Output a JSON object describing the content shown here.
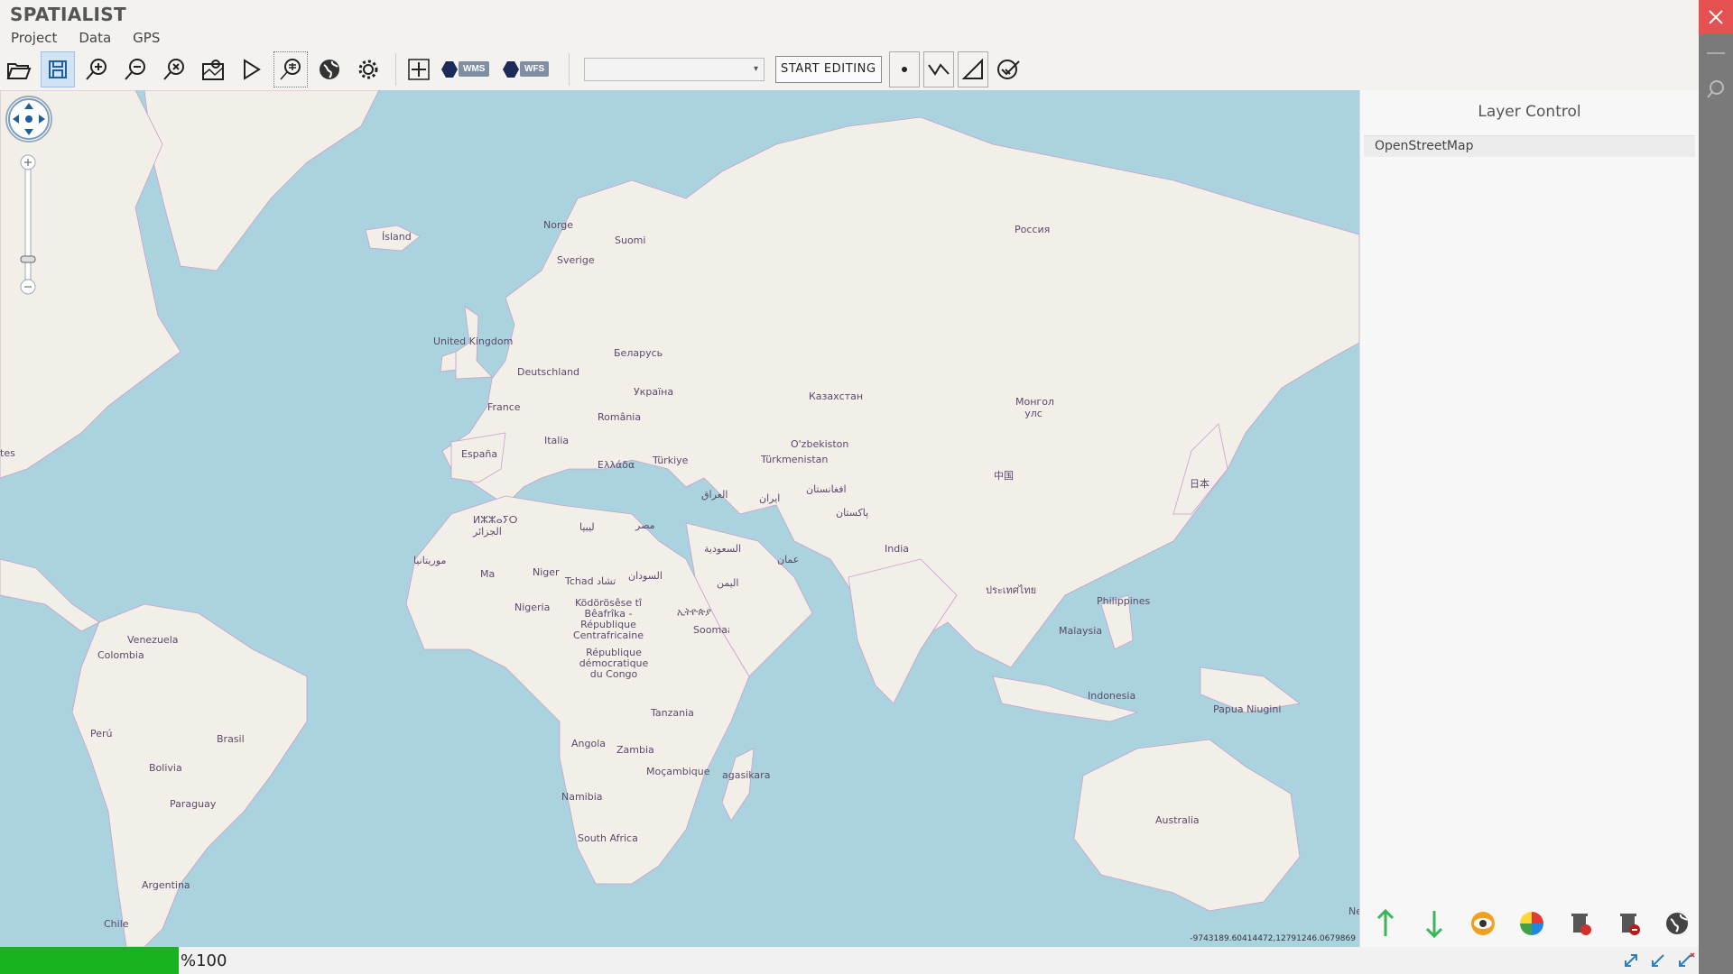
{
  "app": {
    "title": "SPATIALIST"
  },
  "menus": [
    "Project",
    "Data",
    "GPS"
  ],
  "toolbar": {
    "wms_label": "WMS",
    "wfs_label": "WFS",
    "start_editing": "START EDITING"
  },
  "map": {
    "coordinate_readout": "-9743189.60414472,12791246.0679869",
    "labels": [
      {
        "text": "Ísland"
      },
      {
        "text": "Norge"
      },
      {
        "text": "Suomi"
      },
      {
        "text": "Sverige"
      },
      {
        "text": "Россия"
      },
      {
        "text": "United Kingdom"
      },
      {
        "text": "Беларусь"
      },
      {
        "text": "Deutschland"
      },
      {
        "text": "Україна"
      },
      {
        "text": "France"
      },
      {
        "text": "România"
      },
      {
        "text": "Казахстан"
      },
      {
        "text": "Italia"
      },
      {
        "text": "España"
      },
      {
        "text": "Ελλάδα"
      },
      {
        "text": "Türkiye"
      },
      {
        "text": "O'zbekiston"
      },
      {
        "text": "Türkmenistan"
      },
      {
        "text": "Монгол улс"
      },
      {
        "text": "中国"
      },
      {
        "text": "日本"
      },
      {
        "text": "ⵍⵣⵣⴰⵢⵔ الجزائر"
      },
      {
        "text": "ليبيا"
      },
      {
        "text": "مصر"
      },
      {
        "text": "العراق"
      },
      {
        "text": "ایران"
      },
      {
        "text": "افغانستان"
      },
      {
        "text": "پاکستان"
      },
      {
        "text": "السعودية"
      },
      {
        "text": "موريتانيا"
      },
      {
        "text": "Ma"
      },
      {
        "text": "Niger"
      },
      {
        "text": "Tchad تشاد"
      },
      {
        "text": "السودان"
      },
      {
        "text": "عمان"
      },
      {
        "text": "India"
      },
      {
        "text": "اليمن"
      },
      {
        "text": "ประเทศไทย"
      },
      {
        "text": "Philippines"
      },
      {
        "text": "Nigeria"
      },
      {
        "text": "Ködörösêse tî Bêafrîka - République Centrafricaine"
      },
      {
        "text": "ኢትዮጵያ"
      },
      {
        "text": "Soomaaliya"
      },
      {
        "text": "Malaysia"
      },
      {
        "text": "République démocratique du Congo"
      },
      {
        "text": "Indonesia"
      },
      {
        "text": "Papua Niugini"
      },
      {
        "text": "Tanzania"
      },
      {
        "text": "Venezuela"
      },
      {
        "text": "Colombia"
      },
      {
        "text": "Perú"
      },
      {
        "text": "Brasil"
      },
      {
        "text": "Bolivia"
      },
      {
        "text": "Paraguay"
      },
      {
        "text": "Angola"
      },
      {
        "text": "Zambia"
      },
      {
        "text": "Moçambique"
      },
      {
        "text": "Namibia"
      },
      {
        "text": "agasikara"
      },
      {
        "text": "South Africa"
      },
      {
        "text": "Argentina"
      },
      {
        "text": "Chile"
      },
      {
        "text": "Australia"
      },
      {
        "text": "Ne"
      },
      {
        "text": "tes"
      }
    ]
  },
  "layer_control": {
    "title": "Layer Control",
    "layers": [
      "OpenStreetMap"
    ]
  },
  "status": {
    "progress_percent": 10.5,
    "progress_text": "%100"
  },
  "colors": {
    "water": "#aad3df",
    "land": "#f2efe9",
    "border": "#c8a0c8",
    "progress": "#19b21e",
    "close": "#e55151"
  }
}
